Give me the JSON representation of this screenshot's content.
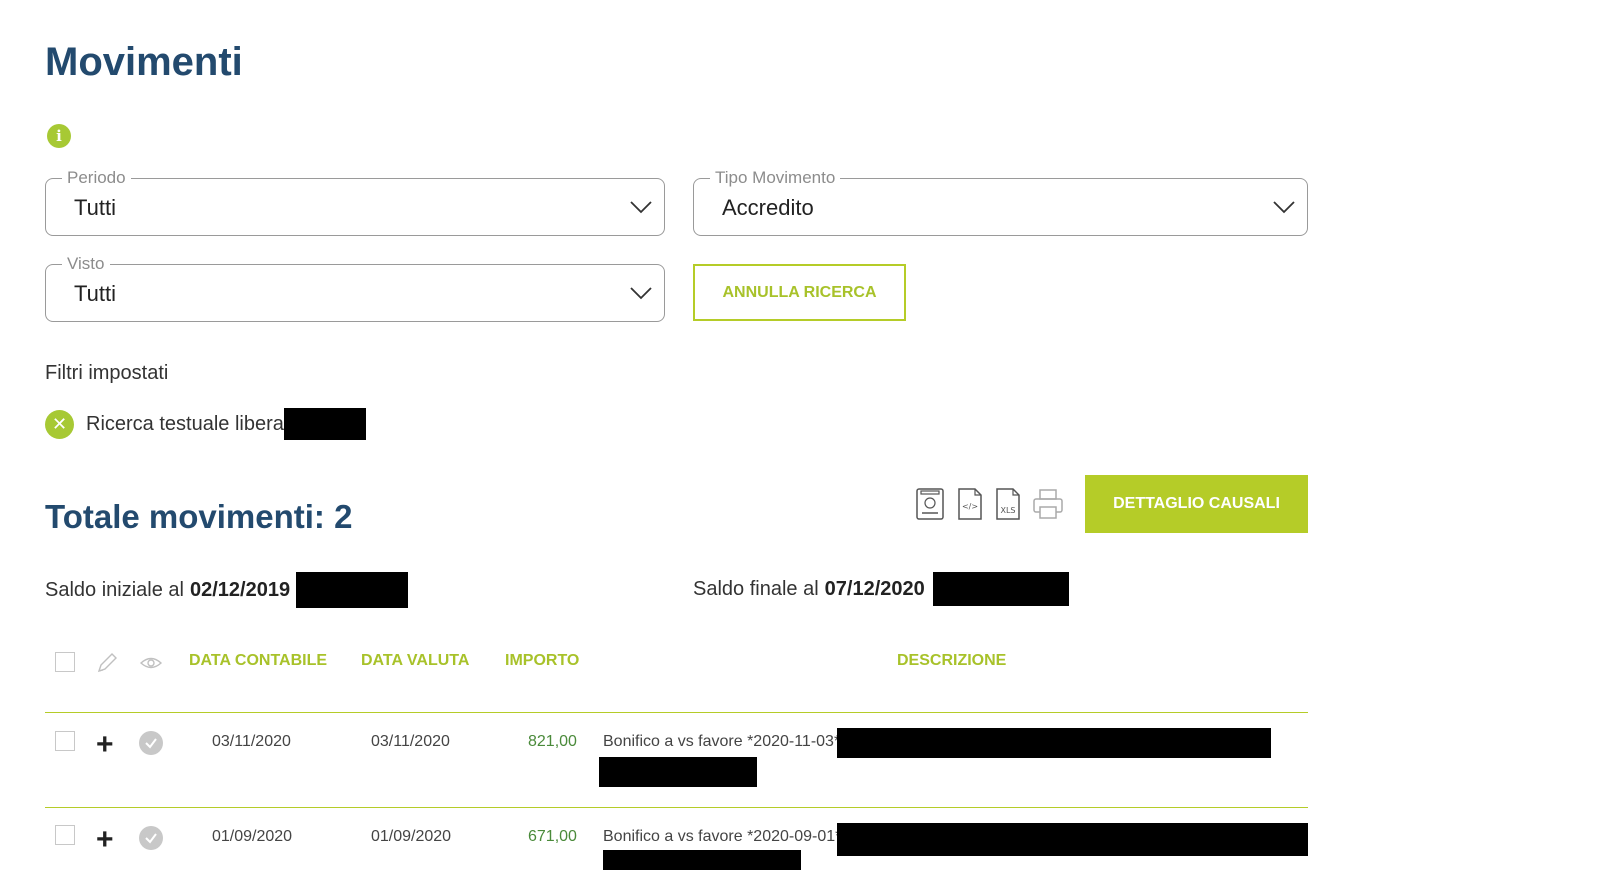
{
  "page": {
    "title": "Movimenti"
  },
  "filters": {
    "periodo": {
      "label": "Periodo",
      "value": "Tutti"
    },
    "tipo_movimento": {
      "label": "Tipo Movimento",
      "value": "Accredito"
    },
    "visto": {
      "label": "Visto",
      "value": "Tutti"
    },
    "annulla_label": "ANNULLA RICERCA"
  },
  "filtri_impostati": {
    "label": "Filtri impostati",
    "items": [
      {
        "text": "Ricerca testuale libera"
      }
    ]
  },
  "summary": {
    "total_label": "Totale movimenti: 2",
    "dettaglio_label": "DETTAGLIO CAUSALI",
    "saldo_iniziale_label": "Saldo iniziale al",
    "saldo_iniziale_date": "02/12/2019",
    "saldo_finale_label": "Saldo finale al",
    "saldo_finale_date": "07/12/2020",
    "export_icons": [
      "pdf-receipt-icon",
      "xml-file-icon",
      "xls-file-icon",
      "printer-icon"
    ],
    "xls_text": "XLS"
  },
  "table": {
    "headers": {
      "data_contabile": "DATA CONTABILE",
      "data_valuta": "DATA VALUTA",
      "importo": "IMPORTO",
      "descrizione": "DESCRIZIONE"
    },
    "rows": [
      {
        "data_contabile": "03/11/2020",
        "data_valuta": "03/11/2020",
        "importo": "821,00",
        "descrizione": "Bonifico a vs favore *2020-11-03*"
      },
      {
        "data_contabile": "01/09/2020",
        "data_valuta": "01/09/2020",
        "importo": "671,00",
        "descrizione": "Bonifico a vs favore *2020-09-01*"
      }
    ]
  },
  "colors": {
    "accent": "#b5cc28",
    "title": "#234a6e",
    "amount": "#4a8a3a",
    "redaction": "#000000"
  }
}
